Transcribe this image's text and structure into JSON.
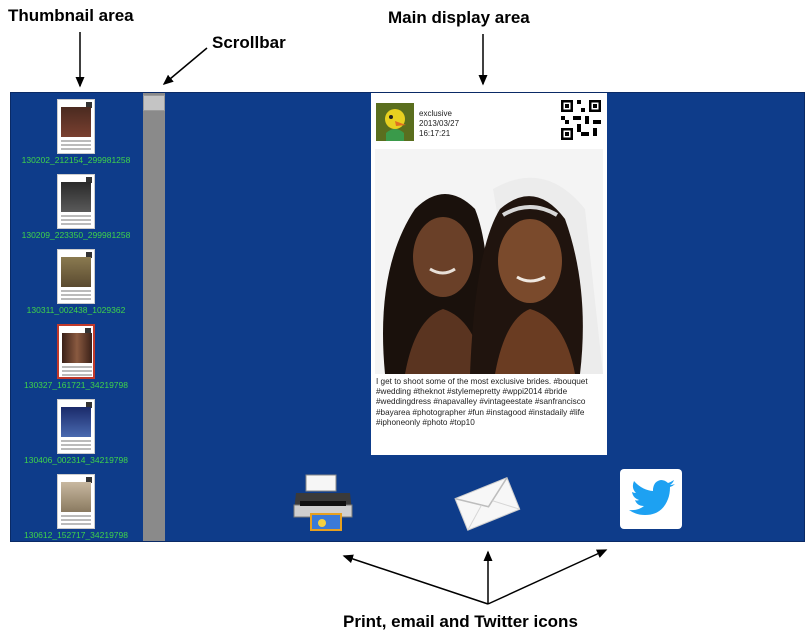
{
  "annotations": {
    "thumbnail_area": "Thumbnail area",
    "scrollbar": "Scrollbar",
    "main_display_area": "Main display area",
    "icons": "Print, email and Twitter icons"
  },
  "thumbnails": [
    {
      "label": "130202_212154_299981258",
      "selected": false
    },
    {
      "label": "130209_223350_299981258",
      "selected": false
    },
    {
      "label": "130311_002438_1029362",
      "selected": false
    },
    {
      "label": "130327_161721_34219798",
      "selected": true
    },
    {
      "label": "130406_002314_34219798",
      "selected": false
    },
    {
      "label": "130612_152717_34219798",
      "selected": false
    }
  ],
  "post": {
    "user": "exclusive",
    "date": "2013/03/27",
    "time": "16:17:21",
    "caption": "I get to shoot some of the most exclusive brides. #bouquet #wedding #theknot #stylemepretty #wppi2014 #bride #weddingdress #napavalley #vintageestate #sanfrancisco #bayarea #photographer #fun #instagood #instadaily #life #iphoneonly #photo #top10"
  },
  "icons": [
    "printer-icon",
    "envelope-icon",
    "twitter-bird-icon"
  ],
  "colors": {
    "background": "#0e3c8a",
    "thumb_label": "#3fd44a",
    "twitter": "#1da1f2",
    "selected_border": "#c0392b"
  }
}
